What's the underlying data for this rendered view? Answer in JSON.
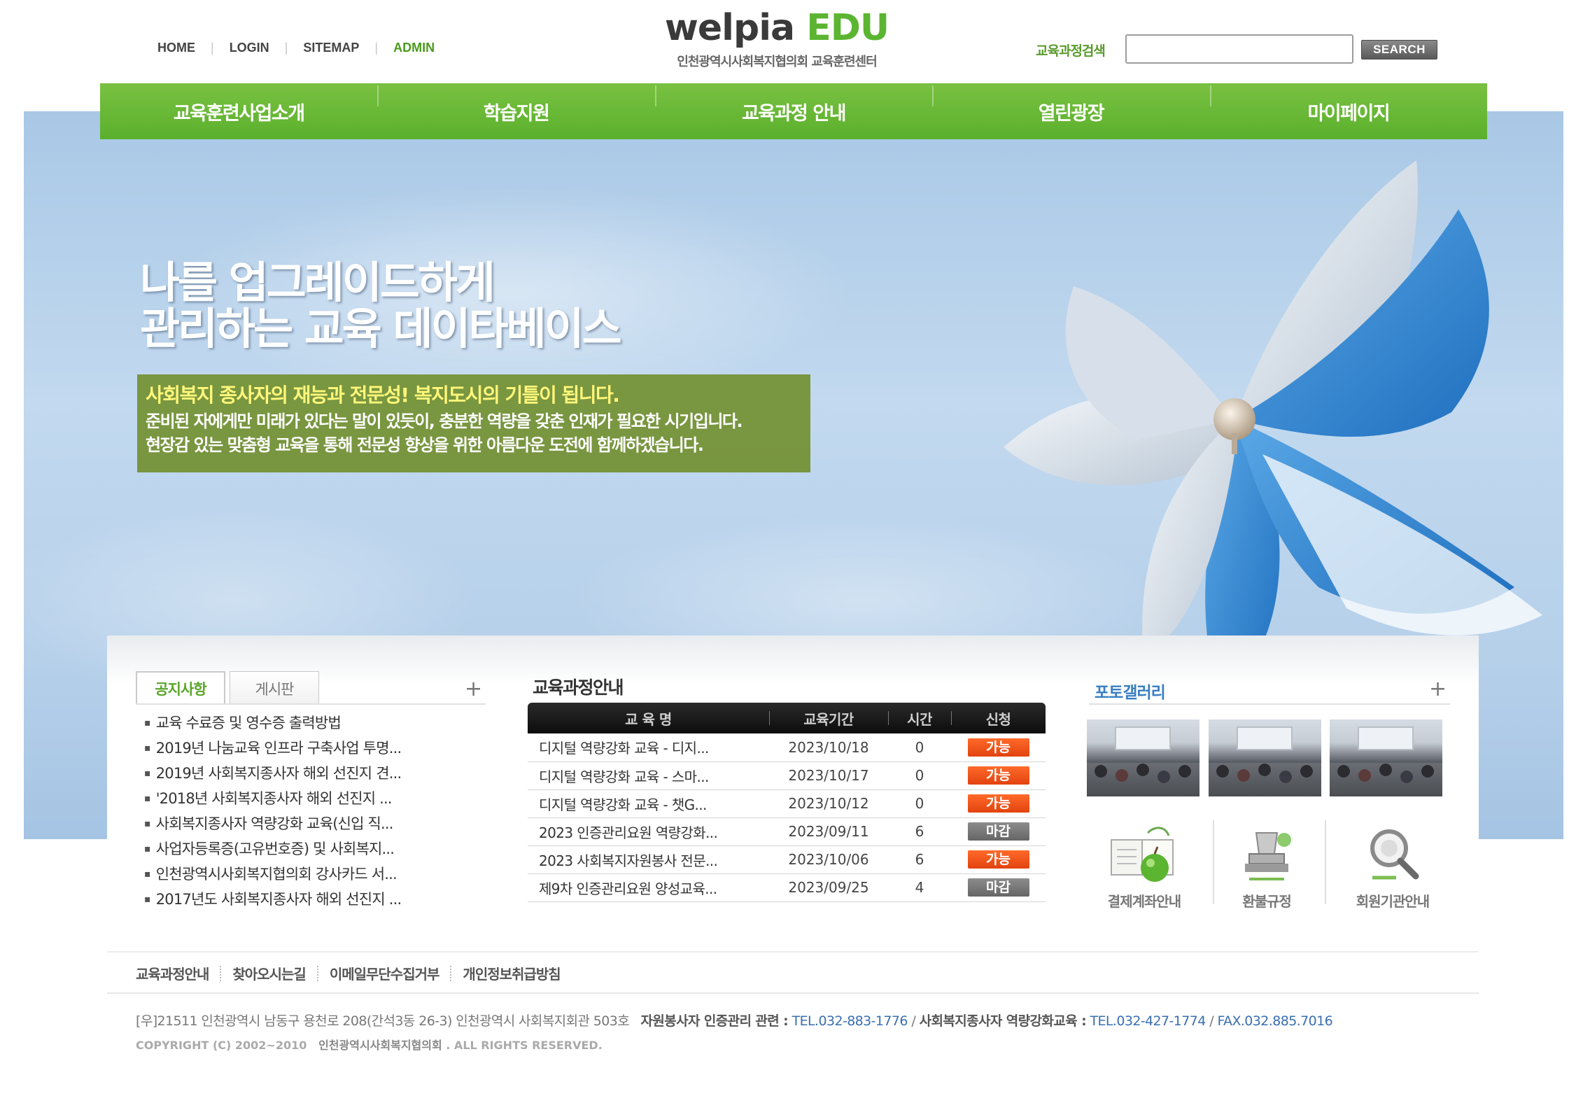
{
  "top_links": [
    "HOME",
    "LOGIN",
    "SITEMAP",
    "ADMIN"
  ],
  "logo": {
    "main_a": "welpia",
    "main_b": " EDU",
    "sub": "인천광역시사회복지협의회 교육훈련센터"
  },
  "search": {
    "label": "교육과정검색",
    "placeholder": "",
    "button": "SEARCH"
  },
  "nav": [
    "교육훈련사업소개",
    "학습지원",
    "교육과정 안내",
    "열린광장",
    "마이페이지"
  ],
  "hero": {
    "title_line1": "나를 업그레이드하게",
    "title_line2": "관리하는 교육 데이타베이스",
    "box_line1": "사회복지 종사자의 재능과 전문성! 복지도시의 기틀이 됩니다.",
    "box_line2": "준비된 자에게만 미래가 있다는 말이 있듯이, 충분한 역량을 갖춘 인재가 필요한 시기입니다.",
    "box_line3": "현장감 있는 맞춤형 교육을 통해 전문성 향상을 위한 아름다운 도전에 함께하겠습니다."
  },
  "notices": {
    "tabs": [
      "공지사항",
      "게시판"
    ],
    "more": "+",
    "items": [
      "교육 수료증 및 영수증 출력방법",
      "2019년 나눔교육 인프라 구축사업 투명...",
      "2019년 사회복지종사자 해외 선진지 견...",
      "'2018년 사회복지종사자 해외 선진지 ...",
      "사회복지종사자 역량강화 교육(신입 직...",
      "사업자등록증(고유번호증) 및 사회복지...",
      "인천광역시사회복지협의회 강사카드 서...",
      "2017년도 사회복지종사자 해외 선진지 ..."
    ]
  },
  "courses": {
    "title": "교육과정안내",
    "headers": [
      "교 육 명",
      "교육기간",
      "시간",
      "신청"
    ],
    "rows": [
      {
        "name": "디지털 역량강화 교육 - 디지...",
        "date": "2023/10/18",
        "hours": "0",
        "status": "가능"
      },
      {
        "name": "디지털 역량강화 교육 - 스마...",
        "date": "2023/10/17",
        "hours": "0",
        "status": "가능"
      },
      {
        "name": "디지털 역량강화 교육 - 챗G...",
        "date": "2023/10/12",
        "hours": "0",
        "status": "가능"
      },
      {
        "name": "2023 인증관리요원 역량강화...",
        "date": "2023/09/11",
        "hours": "6",
        "status": "마감"
      },
      {
        "name": "2023 사회복지자원봉사 전문...",
        "date": "2023/10/06",
        "hours": "6",
        "status": "가능"
      },
      {
        "name": "제9차 인증관리요원 양성교육...",
        "date": "2023/09/25",
        "hours": "4",
        "status": "마감"
      }
    ]
  },
  "gallery": {
    "title": "포토갤러리",
    "more": "+",
    "quick_links": [
      "결제계좌안내",
      "환불규정",
      "회원기관안내"
    ]
  },
  "footer": {
    "links": [
      "교육과정안내",
      "찾아오시는길",
      "이메일무단수집거부",
      "개인정보취급방침"
    ],
    "address": "[우]21511 인천광역시 남동구 용천로 208(간석3동 26-3) 인천광역시 사회복지회관 503호",
    "volunteer_label": "자원봉사자 인증관리 관련 :",
    "volunteer_tel": "TEL.032-883-1776",
    "slash": "/",
    "worker_label": "사회복지종사자 역량강화교육 :",
    "worker_tel": "TEL.032-427-1774",
    "fax": "FAX.032.885.7016",
    "copyright_a": "COPYRIGHT (C) 2002~2010",
    "copyright_b": "인천광역시사회복지협의회",
    "copyright_c": ". ALL RIGHTS RESERVED."
  },
  "colors": {
    "nav_green": "#5ab02c",
    "accent_orange": "#e2430f",
    "gallery_blue": "#3a7fc1"
  }
}
